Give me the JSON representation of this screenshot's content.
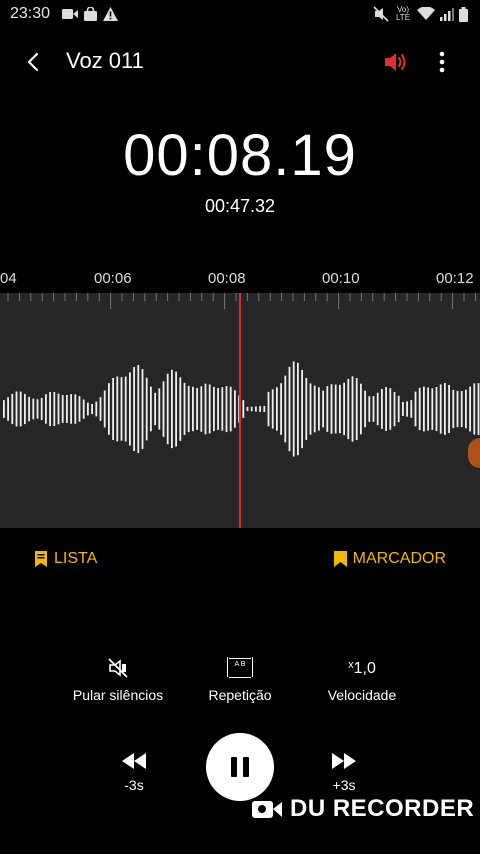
{
  "status_bar": {
    "time": "23:30",
    "network_label": "Vo) LTE"
  },
  "header": {
    "title": "Voz 011",
    "speaker_color": "#e0302e"
  },
  "timer": {
    "elapsed": "00:08.19",
    "total": "00:47.32"
  },
  "timeline": {
    "labels": [
      "04",
      "00:06",
      "00:08",
      "00:10",
      "00:12"
    ],
    "playhead_color": "#e0302e"
  },
  "actions": {
    "list_label": "LISTA",
    "marker_label": "MARCADOR",
    "accent_color": "#f2b700"
  },
  "options": {
    "skip_silence_label": "Pular silêncios",
    "repeat_label": "Repetição",
    "repeat_icon_text": "A B",
    "speed_label": "Velocidade",
    "speed_prefix": "x",
    "speed_value": "1,0"
  },
  "playback": {
    "rewind_label": "-3s",
    "forward_label": "+3s"
  },
  "watermark": {
    "text": "DU RECORDER"
  }
}
